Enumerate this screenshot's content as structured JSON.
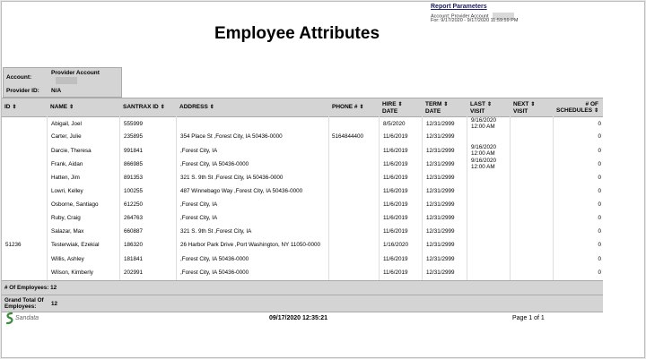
{
  "report_params": {
    "title": "Report Parameters",
    "account_label": "Account: Provider Account",
    "for_text": "For: 9/17/2020 - 9/17/2020 11:59:59 PM"
  },
  "report_title": "Employee Attributes",
  "account": {
    "account_label": "Account:",
    "account_value": "Provider Account",
    "provider_label": "Provider ID:",
    "provider_value": "N/A"
  },
  "columns": {
    "id": "ID",
    "name": "NAME",
    "santrax": "SANTRAX ID",
    "address": "ADDRESS",
    "phone": "PHONE #",
    "hire": [
      "HIRE",
      "DATE"
    ],
    "term": [
      "TERM",
      "DATE"
    ],
    "last": [
      "LAST",
      "VISIT"
    ],
    "next": [
      "NEXT",
      "VISIT"
    ],
    "sched": [
      "# OF",
      "SCHEDULES"
    ]
  },
  "rows": [
    {
      "id": "",
      "name": "Abigail, Joel",
      "santrax": "555999",
      "address": "",
      "phone": "",
      "hire": "8/5/2020",
      "term": "12/31/2999",
      "last1": "9/16/2020",
      "last2": "12:00 AM",
      "next": "",
      "sched": "0"
    },
    {
      "id": "",
      "name": "Carter, Julie",
      "santrax": "235895",
      "address": "354 Place St ,Forest City, IA 50436-0000",
      "phone": "5164844400",
      "hire": "11/6/2019",
      "term": "12/31/2999",
      "last1": "",
      "last2": "",
      "next": "",
      "sched": "0"
    },
    {
      "id": "",
      "name": "Darcie, Theresa",
      "santrax": "991841",
      "address": ",Forest City, IA",
      "phone": "",
      "hire": "11/6/2019",
      "term": "12/31/2999",
      "last1": "9/16/2020",
      "last2": "12:00 AM",
      "next": "",
      "sched": "0"
    },
    {
      "id": "",
      "name": "Frank, Aidan",
      "santrax": "866985",
      "address": ",Forest City, IA 50436-0000",
      "phone": "",
      "hire": "11/6/2019",
      "term": "12/31/2999",
      "last1": "9/16/2020",
      "last2": "12:00 AM",
      "next": "",
      "sched": "0"
    },
    {
      "id": "",
      "name": "Hatten, Jim",
      "santrax": "891353",
      "address": "321 S. 9th St ,Forest City, IA 50436-0000",
      "phone": "",
      "hire": "11/6/2019",
      "term": "12/31/2999",
      "last1": "",
      "last2": "",
      "next": "",
      "sched": "0"
    },
    {
      "id": "",
      "name": "Lowri, Kelley",
      "santrax": "100255",
      "address": "487 Winnebago Way ,Forest City, IA 50436-0000",
      "phone": "",
      "hire": "11/6/2019",
      "term": "12/31/2999",
      "last1": "",
      "last2": "",
      "next": "",
      "sched": "0"
    },
    {
      "id": "",
      "name": "Osborne, Santiago",
      "santrax": "612250",
      "address": ",Forest City, IA",
      "phone": "",
      "hire": "11/6/2019",
      "term": "12/31/2999",
      "last1": "",
      "last2": "",
      "next": "",
      "sched": "0"
    },
    {
      "id": "",
      "name": "Ruby, Craig",
      "santrax": "264763",
      "address": ",Forest City, IA",
      "phone": "",
      "hire": "11/6/2019",
      "term": "12/31/2999",
      "last1": "",
      "last2": "",
      "next": "",
      "sched": "0"
    },
    {
      "id": "",
      "name": "Salazar, Max",
      "santrax": "660887",
      "address": "321 S. 9th St ,Forest City, IA",
      "phone": "",
      "hire": "11/6/2019",
      "term": "12/31/2999",
      "last1": "",
      "last2": "",
      "next": "",
      "sched": "0"
    },
    {
      "id": "51236",
      "name": "Testerwiak, Ezekial",
      "santrax": "186320",
      "address": "26 Harbor Park Drive ,Port Washington, NY 11050-0000",
      "phone": "",
      "hire": "1/16/2020",
      "term": "12/31/2999",
      "last1": "",
      "last2": "",
      "next": "",
      "sched": "0"
    },
    {
      "id": "",
      "name": "Willis, Ashley",
      "santrax": "181841",
      "address": ",Forest City, IA 50436-0000",
      "phone": "",
      "hire": "11/6/2019",
      "term": "12/31/2999",
      "last1": "",
      "last2": "",
      "next": "",
      "sched": "0"
    },
    {
      "id": "",
      "name": "Wilson, Kimberly",
      "santrax": "202991",
      "address": ",Forest City, IA 50436-0000",
      "phone": "",
      "hire": "11/6/2019",
      "term": "12/31/2999",
      "last1": "",
      "last2": "",
      "next": "",
      "sched": "0"
    }
  ],
  "count_label": "# Of Employees:",
  "count_value": "12",
  "grand_label": [
    "Grand Total Of",
    "Employees:"
  ],
  "grand_value": "12",
  "timestamp": "09/17/2020 12:35:21",
  "page_info": "Page 1 of 1",
  "logo_text": "Sandata",
  "sort_icon": "sort-arrows-icon"
}
